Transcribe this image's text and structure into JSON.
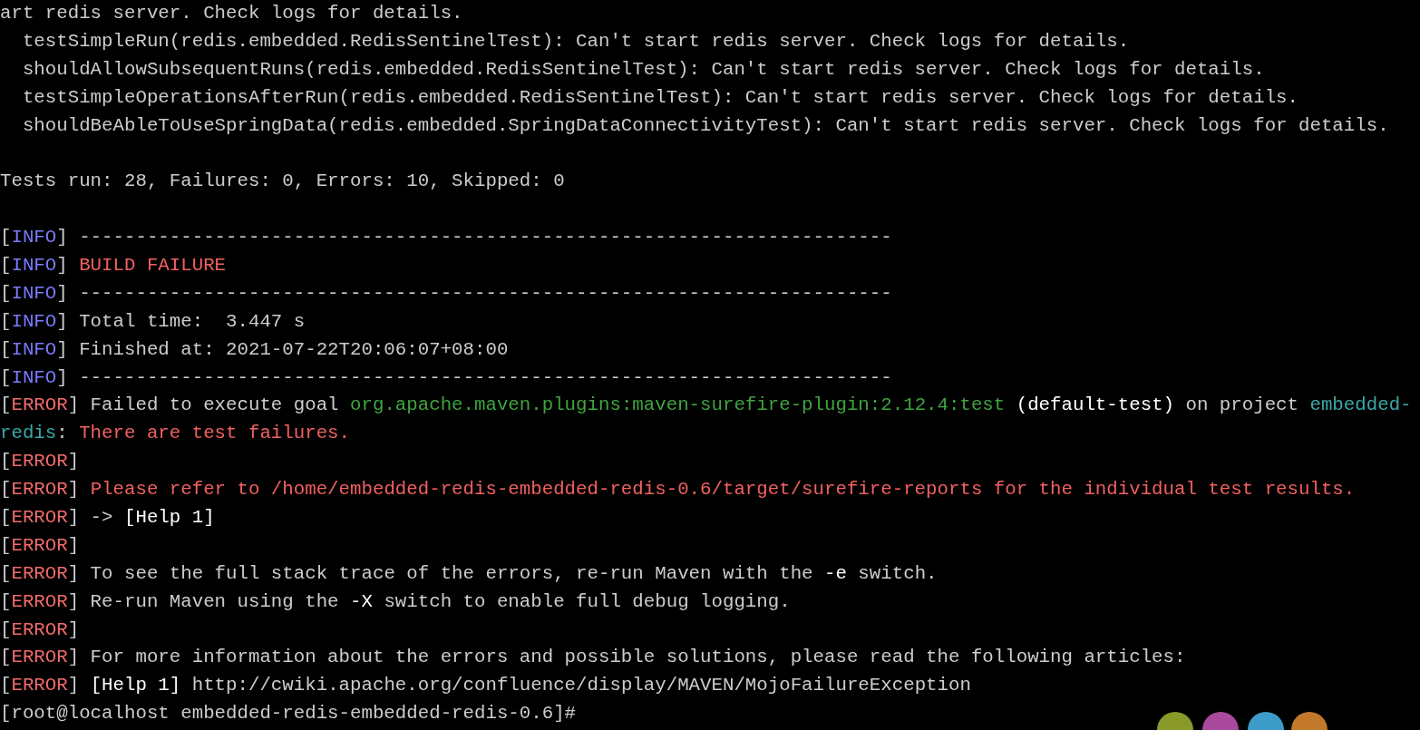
{
  "terminal": {
    "lines": [
      {
        "kind": "text",
        "segments": [
          {
            "kind": "plain",
            "text": "art redis server. Check logs for details."
          }
        ]
      },
      {
        "kind": "text",
        "segments": [
          {
            "kind": "plain",
            "text": "  testSimpleRun(redis.embedded.RedisSentinelTest): Can't start redis server. Check logs for details."
          }
        ]
      },
      {
        "kind": "text",
        "segments": [
          {
            "kind": "plain",
            "text": "  shouldAllowSubsequentRuns(redis.embedded.RedisSentinelTest): Can't start redis server. Check logs for details."
          }
        ]
      },
      {
        "kind": "text",
        "segments": [
          {
            "kind": "plain",
            "text": "  testSimpleOperationsAfterRun(redis.embedded.RedisSentinelTest): Can't start redis server. Check logs for details."
          }
        ]
      },
      {
        "kind": "text",
        "segments": [
          {
            "kind": "plain",
            "text": "  shouldBeAbleToUseSpringData(redis.embedded.SpringDataConnectivityTest): Can't start redis server. Check logs for details."
          }
        ]
      },
      {
        "kind": "blank"
      },
      {
        "kind": "text",
        "segments": [
          {
            "kind": "plain",
            "text": "Tests run: 28, Failures: 0, Errors: 10, Skipped: 0"
          }
        ]
      },
      {
        "kind": "blank"
      },
      {
        "kind": "text",
        "segments": [
          {
            "kind": "plain",
            "text": "["
          },
          {
            "kind": "info",
            "text": "INFO"
          },
          {
            "kind": "plain",
            "text": "] ------------------------------------------------------------------------"
          }
        ]
      },
      {
        "kind": "text",
        "segments": [
          {
            "kind": "plain",
            "text": "["
          },
          {
            "kind": "info",
            "text": "INFO"
          },
          {
            "kind": "plain",
            "text": "] "
          },
          {
            "kind": "failure",
            "text": "BUILD FAILURE"
          }
        ]
      },
      {
        "kind": "text",
        "segments": [
          {
            "kind": "plain",
            "text": "["
          },
          {
            "kind": "info",
            "text": "INFO"
          },
          {
            "kind": "plain",
            "text": "] ------------------------------------------------------------------------"
          }
        ]
      },
      {
        "kind": "text",
        "segments": [
          {
            "kind": "plain",
            "text": "["
          },
          {
            "kind": "info",
            "text": "INFO"
          },
          {
            "kind": "plain",
            "text": "] Total time:  3.447 s"
          }
        ]
      },
      {
        "kind": "text",
        "segments": [
          {
            "kind": "plain",
            "text": "["
          },
          {
            "kind": "info",
            "text": "INFO"
          },
          {
            "kind": "plain",
            "text": "] Finished at: 2021-07-22T20:06:07+08:00"
          }
        ]
      },
      {
        "kind": "text",
        "segments": [
          {
            "kind": "plain",
            "text": "["
          },
          {
            "kind": "info",
            "text": "INFO"
          },
          {
            "kind": "plain",
            "text": "] ------------------------------------------------------------------------"
          }
        ]
      },
      {
        "kind": "text",
        "segments": [
          {
            "kind": "plain",
            "text": "["
          },
          {
            "kind": "error",
            "text": "ERROR"
          },
          {
            "kind": "plain",
            "text": "] Failed to execute goal "
          },
          {
            "kind": "success",
            "text": "org.apache.maven.plugins:maven-surefire-plugin:2.12.4:test"
          },
          {
            "kind": "bright",
            "text": " (default-test)"
          },
          {
            "kind": "plain",
            "text": " on project "
          },
          {
            "kind": "accent",
            "text": "embedded-"
          }
        ]
      },
      {
        "kind": "text",
        "segments": [
          {
            "kind": "accent",
            "text": "redis"
          },
          {
            "kind": "plain",
            "text": ": "
          },
          {
            "kind": "failure",
            "text": "There are test failures."
          }
        ]
      },
      {
        "kind": "text",
        "segments": [
          {
            "kind": "plain",
            "text": "["
          },
          {
            "kind": "error",
            "text": "ERROR"
          },
          {
            "kind": "plain",
            "text": "]"
          }
        ]
      },
      {
        "kind": "text",
        "segments": [
          {
            "kind": "plain",
            "text": "["
          },
          {
            "kind": "error",
            "text": "ERROR"
          },
          {
            "kind": "plain",
            "text": "] "
          },
          {
            "kind": "failure",
            "text": "Please refer to /home/embedded-redis-embedded-redis-0.6/target/surefire-reports for the individual test results."
          }
        ]
      },
      {
        "kind": "text",
        "segments": [
          {
            "kind": "plain",
            "text": "["
          },
          {
            "kind": "error",
            "text": "ERROR"
          },
          {
            "kind": "plain",
            "text": "] -> "
          },
          {
            "kind": "bright",
            "text": "[Help 1]"
          }
        ]
      },
      {
        "kind": "text",
        "segments": [
          {
            "kind": "plain",
            "text": "["
          },
          {
            "kind": "error",
            "text": "ERROR"
          },
          {
            "kind": "plain",
            "text": "]"
          }
        ]
      },
      {
        "kind": "text",
        "segments": [
          {
            "kind": "plain",
            "text": "["
          },
          {
            "kind": "error",
            "text": "ERROR"
          },
          {
            "kind": "plain",
            "text": "] To see the full stack trace of the errors, re-run Maven with the "
          },
          {
            "kind": "bright",
            "text": "-e"
          },
          {
            "kind": "plain",
            "text": " switch."
          }
        ]
      },
      {
        "kind": "text",
        "segments": [
          {
            "kind": "plain",
            "text": "["
          },
          {
            "kind": "error",
            "text": "ERROR"
          },
          {
            "kind": "plain",
            "text": "] Re-run Maven using the "
          },
          {
            "kind": "bright",
            "text": "-X"
          },
          {
            "kind": "plain",
            "text": " switch to enable full debug logging."
          }
        ]
      },
      {
        "kind": "text",
        "segments": [
          {
            "kind": "plain",
            "text": "["
          },
          {
            "kind": "error",
            "text": "ERROR"
          },
          {
            "kind": "plain",
            "text": "]"
          }
        ]
      },
      {
        "kind": "text",
        "segments": [
          {
            "kind": "plain",
            "text": "["
          },
          {
            "kind": "error",
            "text": "ERROR"
          },
          {
            "kind": "plain",
            "text": "] For more information about the errors and possible solutions, please read the following articles:"
          }
        ]
      },
      {
        "kind": "text",
        "segments": [
          {
            "kind": "plain",
            "text": "["
          },
          {
            "kind": "error",
            "text": "ERROR"
          },
          {
            "kind": "plain",
            "text": "] "
          },
          {
            "kind": "bright",
            "text": "[Help 1]"
          },
          {
            "kind": "plain",
            "text": " http://cwiki.apache.org/confluence/display/MAVEN/MojoFailureException"
          }
        ]
      },
      {
        "kind": "text",
        "segments": [
          {
            "kind": "plain",
            "text": "[root@localhost embedded-redis-embedded-redis-0.6]#"
          }
        ]
      }
    ]
  }
}
